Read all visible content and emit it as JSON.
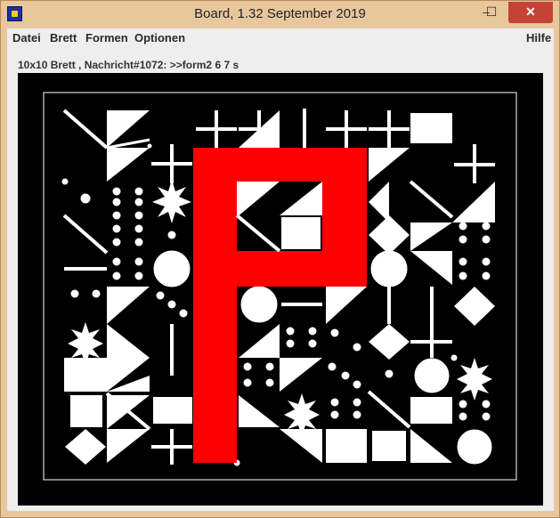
{
  "window": {
    "title": "Board, 1.32   September 2019",
    "minimize_glyph": "‒",
    "maximize_glyph": "☐",
    "close_glyph": "✕"
  },
  "menu": {
    "datei": "Datei",
    "brett": "Brett",
    "formen": "Formen",
    "optionen": "Optionen",
    "hilfe": "Hilfe"
  },
  "status": {
    "text": "10x10 Brett , Nachricht#1072: >>form2 6 7 s"
  },
  "board": {
    "background": "#000000",
    "shape_color": "#ffffff",
    "highlight_color": "#ff0000",
    "highlight_letter": "P",
    "grid_size": 10
  }
}
